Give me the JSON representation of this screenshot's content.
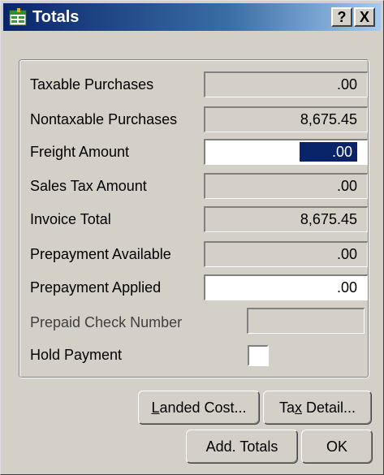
{
  "window": {
    "title": "Totals",
    "help_label": "?",
    "close_label": "X"
  },
  "fields": [
    {
      "label": "Taxable Purchases",
      "value": ".00"
    },
    {
      "label": "Nontaxable Purchases",
      "value": "8,675.45"
    },
    {
      "label": "Freight Amount",
      "value": ".00"
    },
    {
      "label": "Sales Tax Amount",
      "value": ".00"
    },
    {
      "label": "Invoice Total",
      "value": "8,675.45"
    },
    {
      "label": "Prepayment Available",
      "value": ".00"
    },
    {
      "label": "Prepayment Applied",
      "value": ".00"
    },
    {
      "label": "Prepaid Check Number",
      "value": ""
    },
    {
      "label": "Hold Payment",
      "checked": false
    }
  ],
  "buttons": {
    "landed_cost": {
      "pre": "",
      "ul": "L",
      "post": "anded Cost..."
    },
    "tax_detail": {
      "pre": "Ta",
      "ul": "x",
      "post": " Detail..."
    },
    "add_totals": "Add. Totals",
    "ok": "OK"
  },
  "colors": {
    "selection": "#0a246a",
    "titlebar_start": "#0a246a",
    "titlebar_end": "#a6caf0",
    "face": "#d4d0c8"
  },
  "icons": {
    "app": "totals-app-icon"
  }
}
